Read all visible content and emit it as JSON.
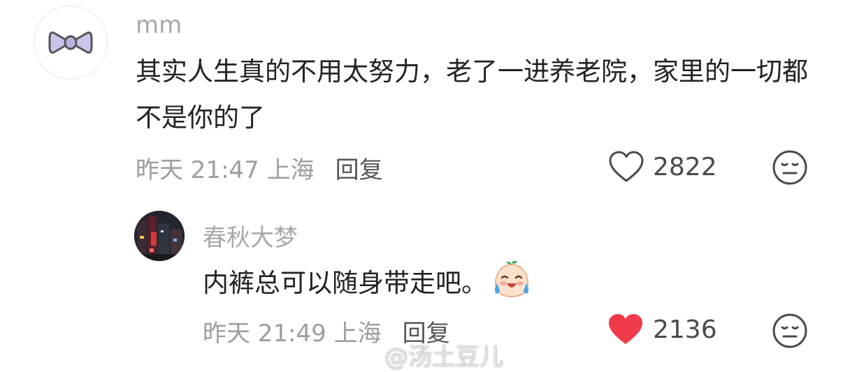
{
  "comment": {
    "username": "mm",
    "text": "其实人生真的不用太努力，老了一进养老院，家里的一切都不是你的了",
    "time": "昨天 21:47 上海",
    "reply_label": "回复",
    "like_count": "2822",
    "liked": false,
    "avatar_icon": "bow-icon"
  },
  "reply": {
    "username": "春秋大梦",
    "text": "内裤总可以随身带走吧。",
    "emoji": "laugh-cry-emoji",
    "time": "昨天 21:49 上海",
    "reply_label": "回复",
    "like_count": "2136",
    "liked": true,
    "like_color": "#f03a4a"
  },
  "watermark": {
    "text": "@汤土豆儿",
    "icon": "weibo-icon"
  }
}
